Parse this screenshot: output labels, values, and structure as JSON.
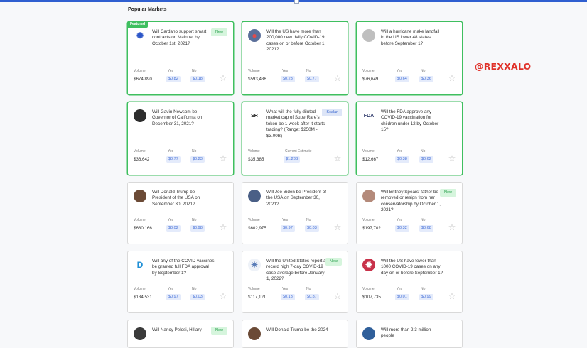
{
  "section_title": "Popular Markets",
  "watermark": "@REXXALO",
  "labels": {
    "volume": "Volume",
    "yes": "Yes",
    "no": "No",
    "current_estimate": "Current Estimate"
  },
  "markets": [
    {
      "question": "Will Cardano support smart contracts on Mainnet by October 1st, 2021?",
      "featured": "Featured",
      "badge": "New",
      "badge_type": "green",
      "volume": "$674,890",
      "yes": "$0.82",
      "no": "$0.18",
      "icon": "cardano-logo-icon",
      "avatar_bg": "#ffffff",
      "avatar_color": "#2c56c8",
      "avatar_glyph": "✺"
    },
    {
      "question": "Will the US have more than 200,000 new daily COVID-19 cases on or before October 1, 2021?",
      "volume": "$593,436",
      "yes": "$0.23",
      "no": "$0.77",
      "icon": "covid-virus-icon",
      "avatar_bg": "#5b6f9a",
      "avatar_color": "#e24b4b",
      "avatar_glyph": "●"
    },
    {
      "question": "Will a hurricane make landfall in the US lower 48 states before September 1?",
      "volume": "$76,649",
      "yes": "$0.64",
      "no": "$0.36",
      "icon": "hurricane-icon",
      "avatar_bg": "#bfbfbf",
      "avatar_color": "#ffffff",
      "avatar_glyph": ""
    },
    {
      "question": "Will Gavin Newsom be Governor of California on December 31, 2021?",
      "volume": "$36,642",
      "yes": "$0.77",
      "no": "$0.23",
      "icon": "gavin-newsom-avatar-icon",
      "avatar_bg": "#2d2d2d",
      "avatar_color": "#e8c9a8",
      "avatar_glyph": ""
    },
    {
      "question": "What will the fully diluted market cap of SuperRare's token be 1 week after it starts trading? (Range: $250M - $3.00B)",
      "badge": "Scalar",
      "badge_type": "blue",
      "volume": "$35,385",
      "estimate": "$1.23B",
      "scalar": true,
      "icon": "superrare-logo-icon",
      "avatar_bg": "#ffffff",
      "avatar_color": "#111111",
      "avatar_glyph": "SR"
    },
    {
      "question": "Will the FDA approve any COVID-19 vaccination for children under 12 by October 15?",
      "volume": "$12,667",
      "yes": "$0.38",
      "no": "$0.62",
      "icon": "fda-logo-icon",
      "avatar_bg": "#ffffff",
      "avatar_color": "#2f3a6b",
      "avatar_glyph": "FDA"
    },
    {
      "question": "Will Donald Trump be President of the USA on September 30, 2021?",
      "volume": "$680,166",
      "yes": "$0.02",
      "no": "$0.98",
      "icon": "donald-trump-avatar-icon",
      "avatar_bg": "#6b4a36",
      "avatar_color": "#e8b98a",
      "avatar_glyph": ""
    },
    {
      "question": "Will Joe Biden be President of the USA on September 30, 2021?",
      "volume": "$602,975",
      "yes": "$0.97",
      "no": "$0.03",
      "icon": "joe-biden-avatar-icon",
      "avatar_bg": "#4a5f86",
      "avatar_color": "#f0d3bb",
      "avatar_glyph": ""
    },
    {
      "question": "Will Britney Spears' father be removed or resign from her conservatorship by October 1, 2021?",
      "badge": "New",
      "badge_type": "green",
      "volume": "$197,702",
      "yes": "$0.32",
      "no": "$0.68",
      "icon": "britney-spears-avatar-icon",
      "avatar_bg": "#b48a7a",
      "avatar_color": "#f2d6c2",
      "avatar_glyph": ""
    },
    {
      "question": "Will any of the COVID vaccines be granted full FDA approval by September 1?",
      "volume": "$134,531",
      "yes": "$0.97",
      "no": "$0.03",
      "icon": "vaccine-logo-icon",
      "avatar_bg": "#ffffff",
      "avatar_color": "#1e8fd6",
      "avatar_glyph": "D"
    },
    {
      "question": "Will the United States report a record high 7-day COVID-19 case average before January 1, 2022?",
      "badge": "New",
      "badge_type": "green",
      "volume": "$117,121",
      "yes": "$0.13",
      "no": "$0.87",
      "icon": "covid-chart-icon",
      "avatar_bg": "#eef2f8",
      "avatar_color": "#5a7db8",
      "avatar_glyph": "✷"
    },
    {
      "question": "Will the US have fewer than 1000 COVID-19 cases on any day on or before September 1?",
      "volume": "$107,735",
      "yes": "$0.01",
      "no": "$0.99",
      "icon": "covid-virus-icon",
      "avatar_bg": "#c8324a",
      "avatar_color": "#ffffff",
      "avatar_glyph": "✹"
    },
    {
      "question": "Will Nancy Pelosi, Hillary",
      "badge": "New",
      "badge_type": "green",
      "partial": true,
      "icon": "nancy-pelosi-avatar-icon",
      "avatar_bg": "#3a3a3a",
      "avatar_color": "#e6c4a6",
      "avatar_glyph": ""
    },
    {
      "question": "Will Donald Trump be the 2024",
      "partial": true,
      "icon": "donald-trump-avatar-icon",
      "avatar_bg": "#6b4a36",
      "avatar_color": "#e8b98a",
      "avatar_glyph": ""
    },
    {
      "question": "Will more than 2.3 million people",
      "partial": true,
      "icon": "covid-globe-icon",
      "avatar_bg": "#2f5f9a",
      "avatar_color": "#ffffff",
      "avatar_glyph": ""
    }
  ]
}
